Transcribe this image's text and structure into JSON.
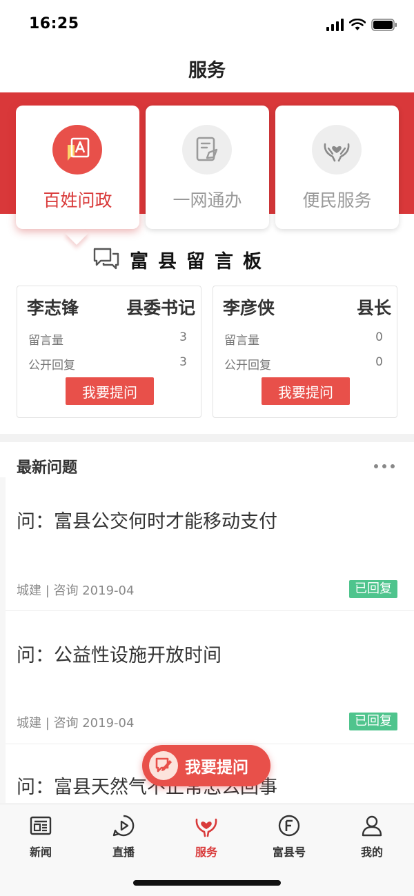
{
  "status_bar": {
    "time": "16:25"
  },
  "header": {
    "title": "服务"
  },
  "services": [
    {
      "label": "百姓问政",
      "icon": "chat-a-icon",
      "active": true
    },
    {
      "label": "一网通办",
      "icon": "edit-document-icon",
      "active": false
    },
    {
      "label": "便民服务",
      "icon": "heart-hands-icon",
      "active": false
    }
  ],
  "board": {
    "title": "富县留言板",
    "icon": "message-bubbles-icon"
  },
  "officials": [
    {
      "name": "李志锋",
      "role": "县委书记",
      "messages_label": "留言量",
      "messages": "3",
      "replies_label": "公开回复",
      "replies": "3",
      "button": "我要提问"
    },
    {
      "name": "李彦侠",
      "role": "县长",
      "messages_label": "留言量",
      "messages": "0",
      "replies_label": "公开回复",
      "replies": "0",
      "button": "我要提问"
    }
  ],
  "latest": {
    "title": "最新问题",
    "items": [
      {
        "text": "问：富县公交何时才能移动支付",
        "meta": "城建 | 咨询   2019-04",
        "status": "已回复"
      },
      {
        "text": "问：公益性设施开放时间",
        "meta": "城建 | 咨询   2019-04",
        "status": "已回复"
      },
      {
        "text": "问：富县天然气不正常怎么回事",
        "meta": "",
        "status": ""
      }
    ]
  },
  "fab": {
    "label": "我要提问"
  },
  "tabs": [
    {
      "label": "新闻",
      "icon": "news-icon",
      "active": false
    },
    {
      "label": "直播",
      "icon": "live-play-icon",
      "active": false
    },
    {
      "label": "服务",
      "icon": "service-heart-icon",
      "active": true
    },
    {
      "label": "富县号",
      "icon": "fuxian-f-icon",
      "active": false
    },
    {
      "label": "我的",
      "icon": "profile-icon",
      "active": false
    }
  ],
  "colors": {
    "brand_red": "#d9383a",
    "button_red": "#e8504a",
    "reply_green": "#4fc48d"
  }
}
